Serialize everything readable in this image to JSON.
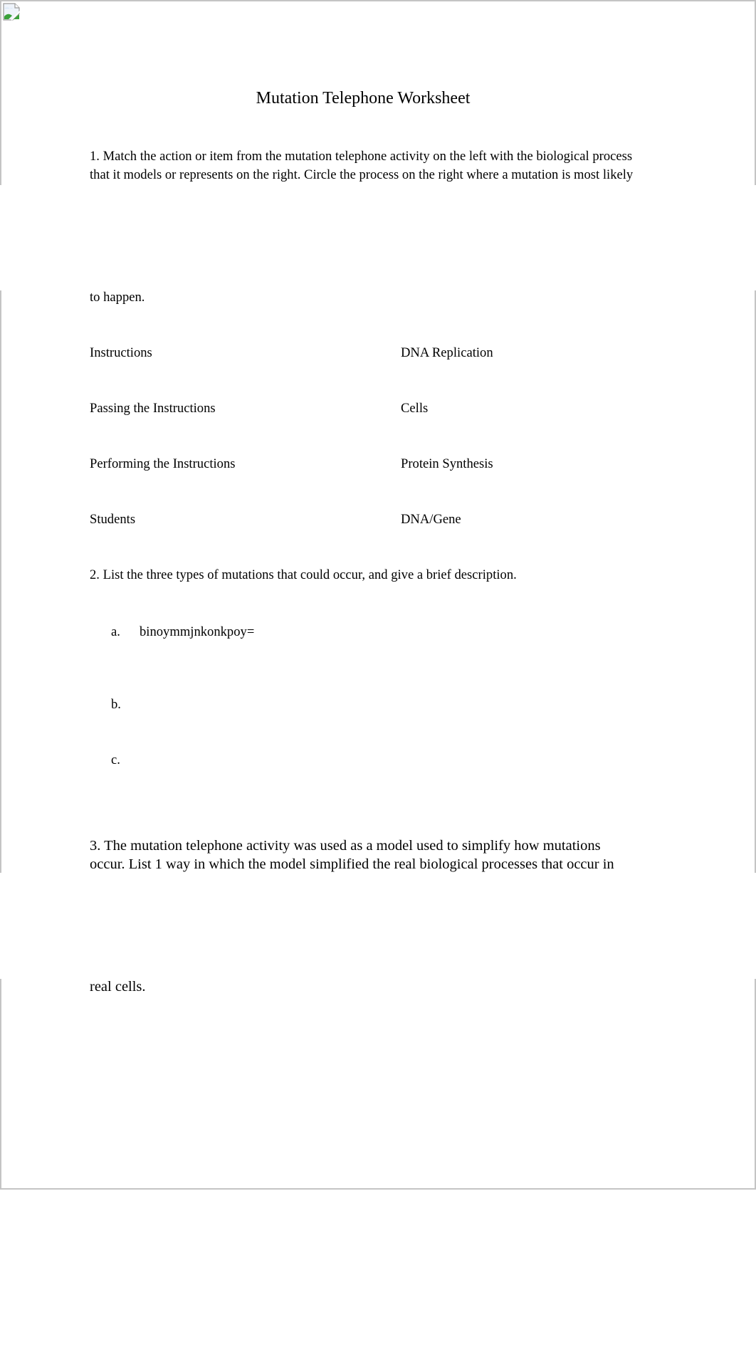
{
  "document": {
    "title": "Mutation Telephone Worksheet",
    "broken_image_icon": "broken-image-icon",
    "question1": {
      "line1": "1. Match the action or item from the mutation telephone activity on the left with the biological process",
      "line2": "that it models or represents on the right. Circle the process on the right where a mutation is most likely",
      "line3": "to happen.",
      "left_items": [
        "Instructions",
        "Passing the Instructions",
        "Performing the Instructions",
        "Students"
      ],
      "right_items": [
        "DNA Replication",
        "Cells",
        "Protein Synthesis",
        "DNA/Gene"
      ]
    },
    "question2": {
      "prompt": "2. List the three types of mutations that could occur, and give a brief description.",
      "answers": [
        {
          "label": "a.",
          "value": "binoymmjnkonkpoy="
        },
        {
          "label": "b.",
          "value": ""
        },
        {
          "label": "c.",
          "value": ""
        }
      ]
    },
    "question3": {
      "line1": "3. The mutation telephone activity was used as a model used to simplify how mutations",
      "line2": "occur. List 1 way in which the model simplified the real biological processes that occur in",
      "line3": "real cells."
    }
  }
}
